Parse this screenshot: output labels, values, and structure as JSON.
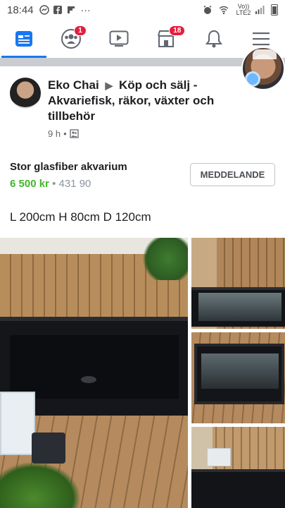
{
  "status_bar": {
    "time": "18:44",
    "network_label": "Vo)) LTE2",
    "battery_icon": "battery-icon"
  },
  "nav": {
    "accent_color": "#1877f2",
    "tabs": [
      {
        "name": "news-feed",
        "icon": "news-feed-icon",
        "active": true,
        "badge": ""
      },
      {
        "name": "groups",
        "icon": "groups-icon",
        "active": false,
        "badge": "1"
      },
      {
        "name": "watch",
        "icon": "watch-icon",
        "active": false,
        "badge": ""
      },
      {
        "name": "marketplace",
        "icon": "marketplace-icon",
        "active": false,
        "badge": "18"
      },
      {
        "name": "notifications",
        "icon": "bell-icon",
        "active": false,
        "badge": ""
      },
      {
        "name": "menu",
        "icon": "hamburger-icon",
        "active": false,
        "badge": ""
      }
    ]
  },
  "post": {
    "author": "Eko Chai",
    "group": "Köp och sälj - Akvariefisk, räkor, växter och tillbehör",
    "time": "9 h",
    "separator": "•",
    "privacy_icon": "group-privacy-icon"
  },
  "listing": {
    "title": "Stor glasfiber akvarium",
    "price": "6 500 kr",
    "separator": "•",
    "old_price": "431 90",
    "message_button": "MEDDELANDE",
    "description": "L 200cm H 80cm D 120cm",
    "price_color": "#42b72a"
  }
}
